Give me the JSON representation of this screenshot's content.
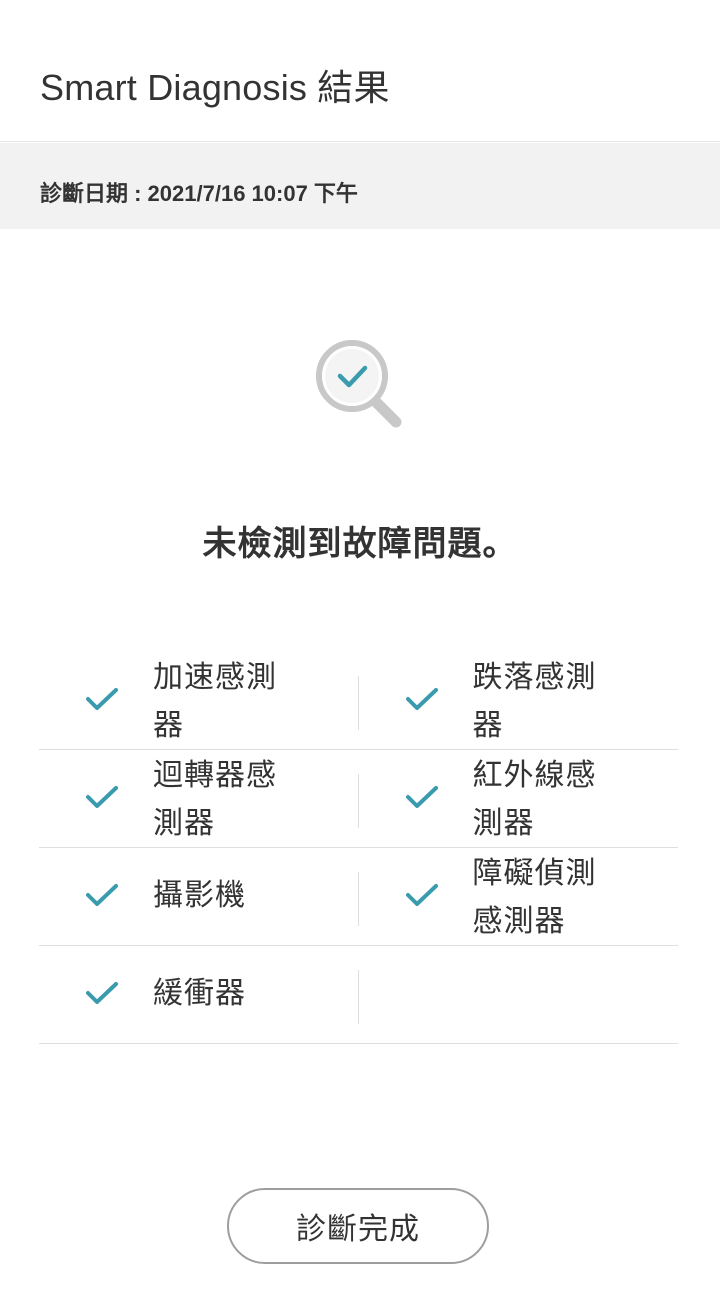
{
  "header": {
    "title": "Smart Diagnosis 結果"
  },
  "diagnosis": {
    "date_label": "診斷日期 : 2021/7/16 10:07 下午"
  },
  "result": {
    "icon": "magnifier-check-icon",
    "message": "未檢測到故障問題。"
  },
  "checks": [
    {
      "label": "加速感測器",
      "status": "ok"
    },
    {
      "label": "跌落感測器",
      "status": "ok"
    },
    {
      "label": "迴轉器感測器",
      "status": "ok"
    },
    {
      "label": "紅外線感測器",
      "status": "ok"
    },
    {
      "label": "攝影機",
      "status": "ok"
    },
    {
      "label": "障礙偵測感測器",
      "status": "ok"
    },
    {
      "label": "緩衝器",
      "status": "ok"
    }
  ],
  "actions": {
    "done_label": "診斷完成"
  },
  "colors": {
    "check_teal": "#3a9bae",
    "magnifier_gray": "#c8c8c8",
    "date_bar_bg": "#f2f2f2",
    "text": "#333333"
  }
}
